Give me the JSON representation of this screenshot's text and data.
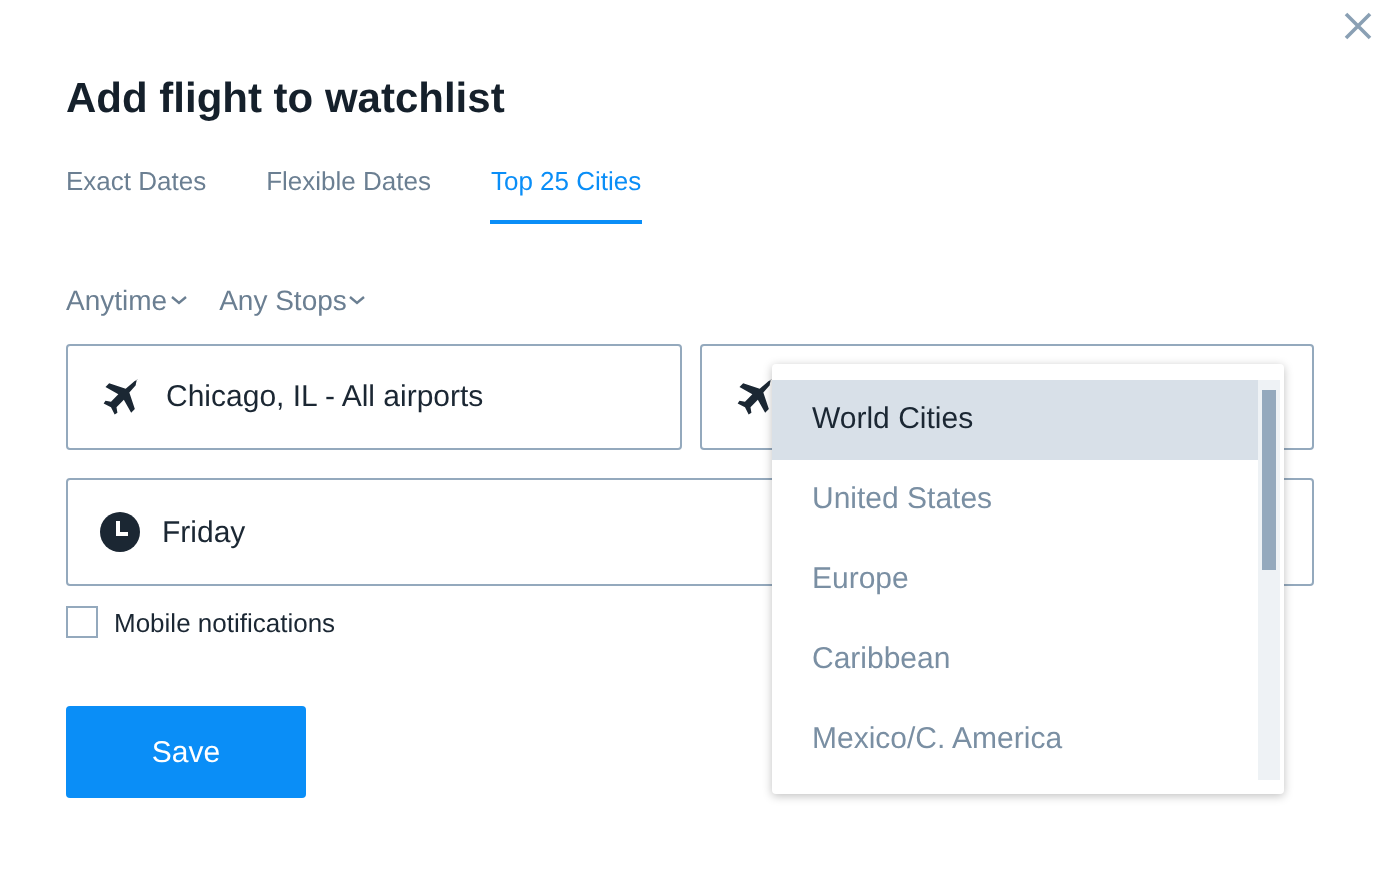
{
  "title": "Add flight to watchlist",
  "tabs": [
    {
      "label": "Exact Dates",
      "selected": false
    },
    {
      "label": "Flexible Dates",
      "selected": false
    },
    {
      "label": "Top 25 Cities",
      "selected": true
    }
  ],
  "filters": [
    {
      "label": "Anytime"
    },
    {
      "label": "Any Stops"
    }
  ],
  "origin": {
    "value": "Chicago, IL - All airports"
  },
  "day": {
    "value": "Friday"
  },
  "mobile_notifications": {
    "label": "Mobile notifications",
    "checked": false
  },
  "save_button": "Save",
  "dropdown": {
    "options": [
      {
        "label": "World Cities",
        "selected": true
      },
      {
        "label": "United States",
        "selected": false
      },
      {
        "label": "Europe",
        "selected": false
      },
      {
        "label": "Caribbean",
        "selected": false
      },
      {
        "label": "Mexico/C. America",
        "selected": false
      }
    ]
  }
}
